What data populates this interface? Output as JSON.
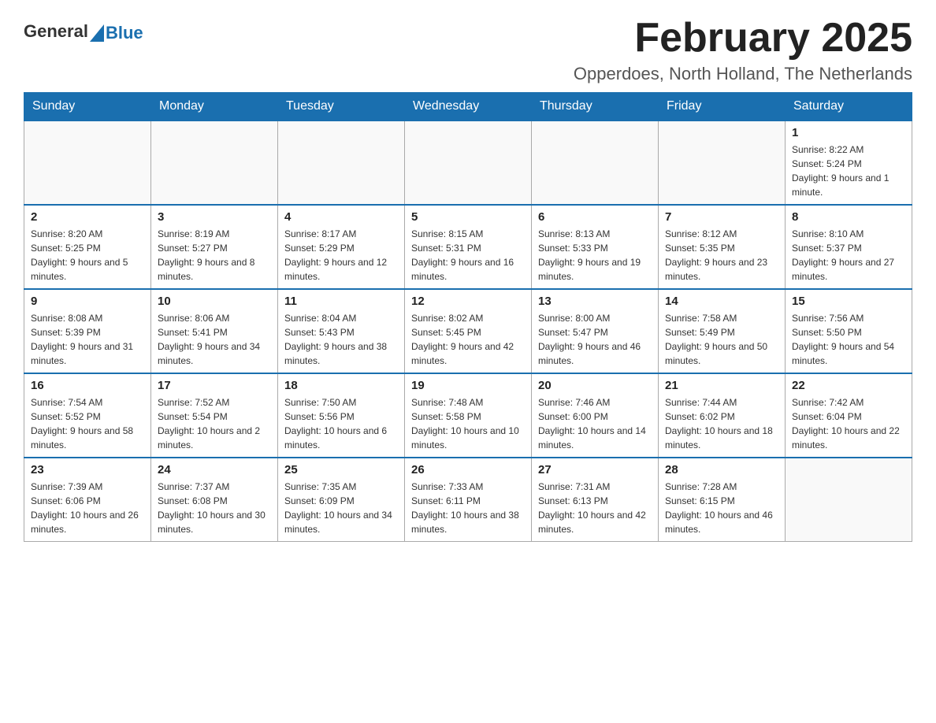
{
  "header": {
    "logo_general": "General",
    "logo_blue": "Blue",
    "month_title": "February 2025",
    "location": "Opperdoes, North Holland, The Netherlands"
  },
  "days_of_week": [
    "Sunday",
    "Monday",
    "Tuesday",
    "Wednesday",
    "Thursday",
    "Friday",
    "Saturday"
  ],
  "weeks": [
    [
      {
        "day": "",
        "info": ""
      },
      {
        "day": "",
        "info": ""
      },
      {
        "day": "",
        "info": ""
      },
      {
        "day": "",
        "info": ""
      },
      {
        "day": "",
        "info": ""
      },
      {
        "day": "",
        "info": ""
      },
      {
        "day": "1",
        "info": "Sunrise: 8:22 AM\nSunset: 5:24 PM\nDaylight: 9 hours and 1 minute."
      }
    ],
    [
      {
        "day": "2",
        "info": "Sunrise: 8:20 AM\nSunset: 5:25 PM\nDaylight: 9 hours and 5 minutes."
      },
      {
        "day": "3",
        "info": "Sunrise: 8:19 AM\nSunset: 5:27 PM\nDaylight: 9 hours and 8 minutes."
      },
      {
        "day": "4",
        "info": "Sunrise: 8:17 AM\nSunset: 5:29 PM\nDaylight: 9 hours and 12 minutes."
      },
      {
        "day": "5",
        "info": "Sunrise: 8:15 AM\nSunset: 5:31 PM\nDaylight: 9 hours and 16 minutes."
      },
      {
        "day": "6",
        "info": "Sunrise: 8:13 AM\nSunset: 5:33 PM\nDaylight: 9 hours and 19 minutes."
      },
      {
        "day": "7",
        "info": "Sunrise: 8:12 AM\nSunset: 5:35 PM\nDaylight: 9 hours and 23 minutes."
      },
      {
        "day": "8",
        "info": "Sunrise: 8:10 AM\nSunset: 5:37 PM\nDaylight: 9 hours and 27 minutes."
      }
    ],
    [
      {
        "day": "9",
        "info": "Sunrise: 8:08 AM\nSunset: 5:39 PM\nDaylight: 9 hours and 31 minutes."
      },
      {
        "day": "10",
        "info": "Sunrise: 8:06 AM\nSunset: 5:41 PM\nDaylight: 9 hours and 34 minutes."
      },
      {
        "day": "11",
        "info": "Sunrise: 8:04 AM\nSunset: 5:43 PM\nDaylight: 9 hours and 38 minutes."
      },
      {
        "day": "12",
        "info": "Sunrise: 8:02 AM\nSunset: 5:45 PM\nDaylight: 9 hours and 42 minutes."
      },
      {
        "day": "13",
        "info": "Sunrise: 8:00 AM\nSunset: 5:47 PM\nDaylight: 9 hours and 46 minutes."
      },
      {
        "day": "14",
        "info": "Sunrise: 7:58 AM\nSunset: 5:49 PM\nDaylight: 9 hours and 50 minutes."
      },
      {
        "day": "15",
        "info": "Sunrise: 7:56 AM\nSunset: 5:50 PM\nDaylight: 9 hours and 54 minutes."
      }
    ],
    [
      {
        "day": "16",
        "info": "Sunrise: 7:54 AM\nSunset: 5:52 PM\nDaylight: 9 hours and 58 minutes."
      },
      {
        "day": "17",
        "info": "Sunrise: 7:52 AM\nSunset: 5:54 PM\nDaylight: 10 hours and 2 minutes."
      },
      {
        "day": "18",
        "info": "Sunrise: 7:50 AM\nSunset: 5:56 PM\nDaylight: 10 hours and 6 minutes."
      },
      {
        "day": "19",
        "info": "Sunrise: 7:48 AM\nSunset: 5:58 PM\nDaylight: 10 hours and 10 minutes."
      },
      {
        "day": "20",
        "info": "Sunrise: 7:46 AM\nSunset: 6:00 PM\nDaylight: 10 hours and 14 minutes."
      },
      {
        "day": "21",
        "info": "Sunrise: 7:44 AM\nSunset: 6:02 PM\nDaylight: 10 hours and 18 minutes."
      },
      {
        "day": "22",
        "info": "Sunrise: 7:42 AM\nSunset: 6:04 PM\nDaylight: 10 hours and 22 minutes."
      }
    ],
    [
      {
        "day": "23",
        "info": "Sunrise: 7:39 AM\nSunset: 6:06 PM\nDaylight: 10 hours and 26 minutes."
      },
      {
        "day": "24",
        "info": "Sunrise: 7:37 AM\nSunset: 6:08 PM\nDaylight: 10 hours and 30 minutes."
      },
      {
        "day": "25",
        "info": "Sunrise: 7:35 AM\nSunset: 6:09 PM\nDaylight: 10 hours and 34 minutes."
      },
      {
        "day": "26",
        "info": "Sunrise: 7:33 AM\nSunset: 6:11 PM\nDaylight: 10 hours and 38 minutes."
      },
      {
        "day": "27",
        "info": "Sunrise: 7:31 AM\nSunset: 6:13 PM\nDaylight: 10 hours and 42 minutes."
      },
      {
        "day": "28",
        "info": "Sunrise: 7:28 AM\nSunset: 6:15 PM\nDaylight: 10 hours and 46 minutes."
      },
      {
        "day": "",
        "info": ""
      }
    ]
  ]
}
